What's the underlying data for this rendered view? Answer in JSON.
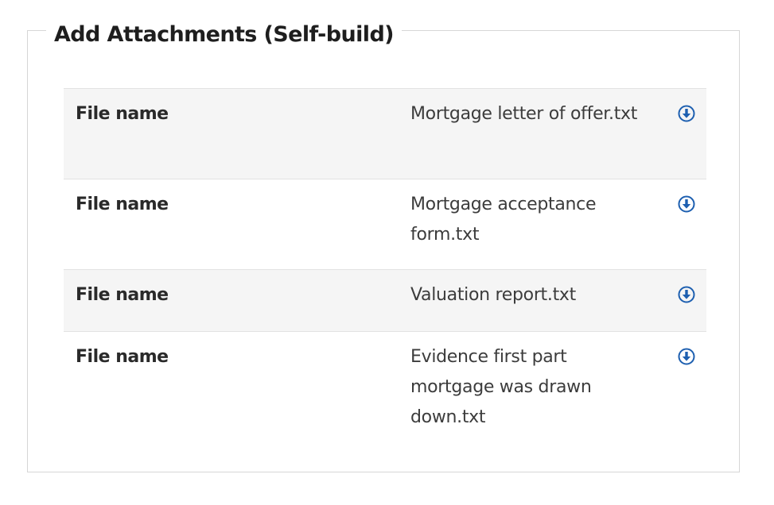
{
  "section": {
    "title": "Add Attachments (Self-build)"
  },
  "attachments": [
    {
      "label": "File name",
      "file": "Mortgage letter of offer.txt",
      "icon": "download-icon"
    },
    {
      "label": "File name",
      "file": "Mortgage acceptance form.txt",
      "icon": "download-icon"
    },
    {
      "label": "File name",
      "file": "Valuation report.txt",
      "icon": "download-icon"
    },
    {
      "label": "File name",
      "file": "Evidence first part mortgage was drawn down.txt",
      "icon": "download-icon"
    }
  ],
  "colors": {
    "accent": "#1d5fb0",
    "row_shade": "#f5f5f5",
    "border": "#d6d6d6"
  }
}
